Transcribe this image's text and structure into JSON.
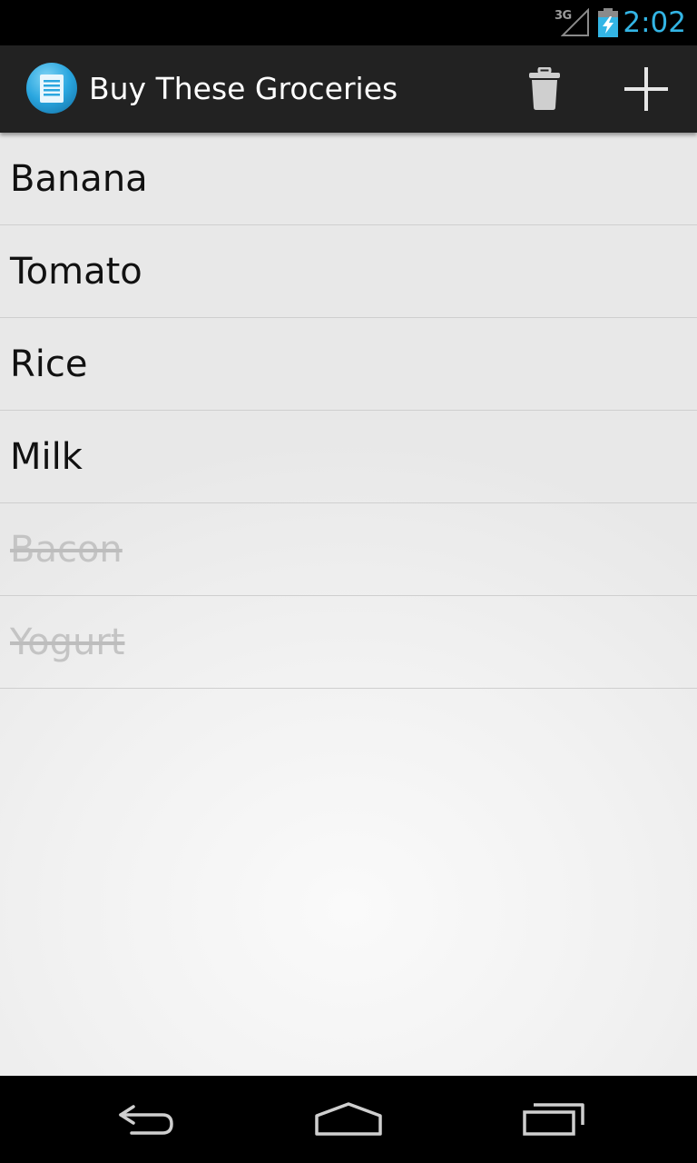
{
  "status_bar": {
    "network": "3G",
    "time": "2:02",
    "time_color": "#33b5e5",
    "icons": [
      "signal-icon",
      "battery-charging-icon"
    ]
  },
  "action_bar": {
    "title": "Buy These Groceries",
    "app_icon": "notepad-icon",
    "actions": [
      {
        "name": "delete",
        "icon": "trash-icon"
      },
      {
        "name": "add",
        "icon": "plus-icon"
      }
    ]
  },
  "list": {
    "items": [
      {
        "label": "Banana",
        "checked": false
      },
      {
        "label": "Tomato",
        "checked": false
      },
      {
        "label": "Rice",
        "checked": false
      },
      {
        "label": "Milk",
        "checked": false
      },
      {
        "label": "Bacon",
        "checked": true
      },
      {
        "label": "Yogurt",
        "checked": true
      }
    ]
  },
  "nav_bar": {
    "buttons": [
      {
        "name": "back",
        "icon": "back-arrow-icon"
      },
      {
        "name": "home",
        "icon": "home-icon"
      },
      {
        "name": "recent-apps",
        "icon": "recent-apps-icon"
      }
    ]
  }
}
